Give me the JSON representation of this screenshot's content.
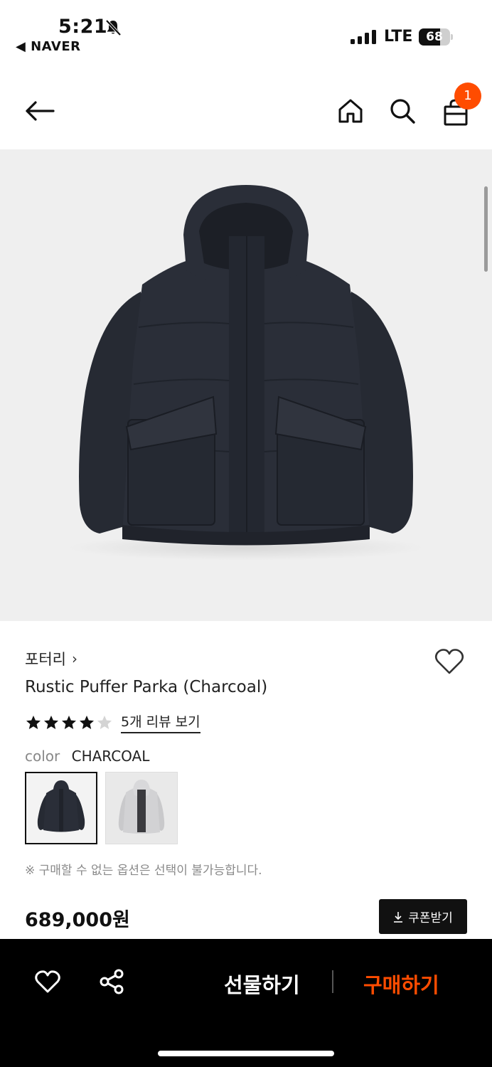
{
  "status_bar": {
    "time": "5:21",
    "back_app": "◀ NAVER",
    "network": "LTE",
    "battery_level": 68,
    "battery_text": "68"
  },
  "header": {
    "back_icon": "arrow-left-icon",
    "home_icon": "home-icon",
    "search_icon": "search-icon",
    "cart_icon": "shopping-bag-icon",
    "cart_badge": "1"
  },
  "product": {
    "image_alt": "Rustic Puffer Parka (Charcoal)",
    "brand": "포터리",
    "brand_chevron": "›",
    "name": "Rustic Puffer Parka (Charcoal)",
    "rating": 4,
    "max_rating": 5,
    "review_link": "5개 리뷰 보기",
    "color_label": "color",
    "color_value": "CHARCOAL",
    "swatches": [
      {
        "name": "charcoal",
        "selected": true
      },
      {
        "name": "light gray",
        "selected": false
      }
    ],
    "notice": "※ 구매할 수 없는 옵션은 선택이 불가능합니다.",
    "price": "689,000원",
    "coupon_label": "쿠폰받기"
  },
  "bottom_bar": {
    "gift_label": "선물하기",
    "buy_label": "구매하기"
  },
  "colors": {
    "accent": "#ff4c00",
    "jacket": "#262a33",
    "bottom_bar": "#000000"
  }
}
